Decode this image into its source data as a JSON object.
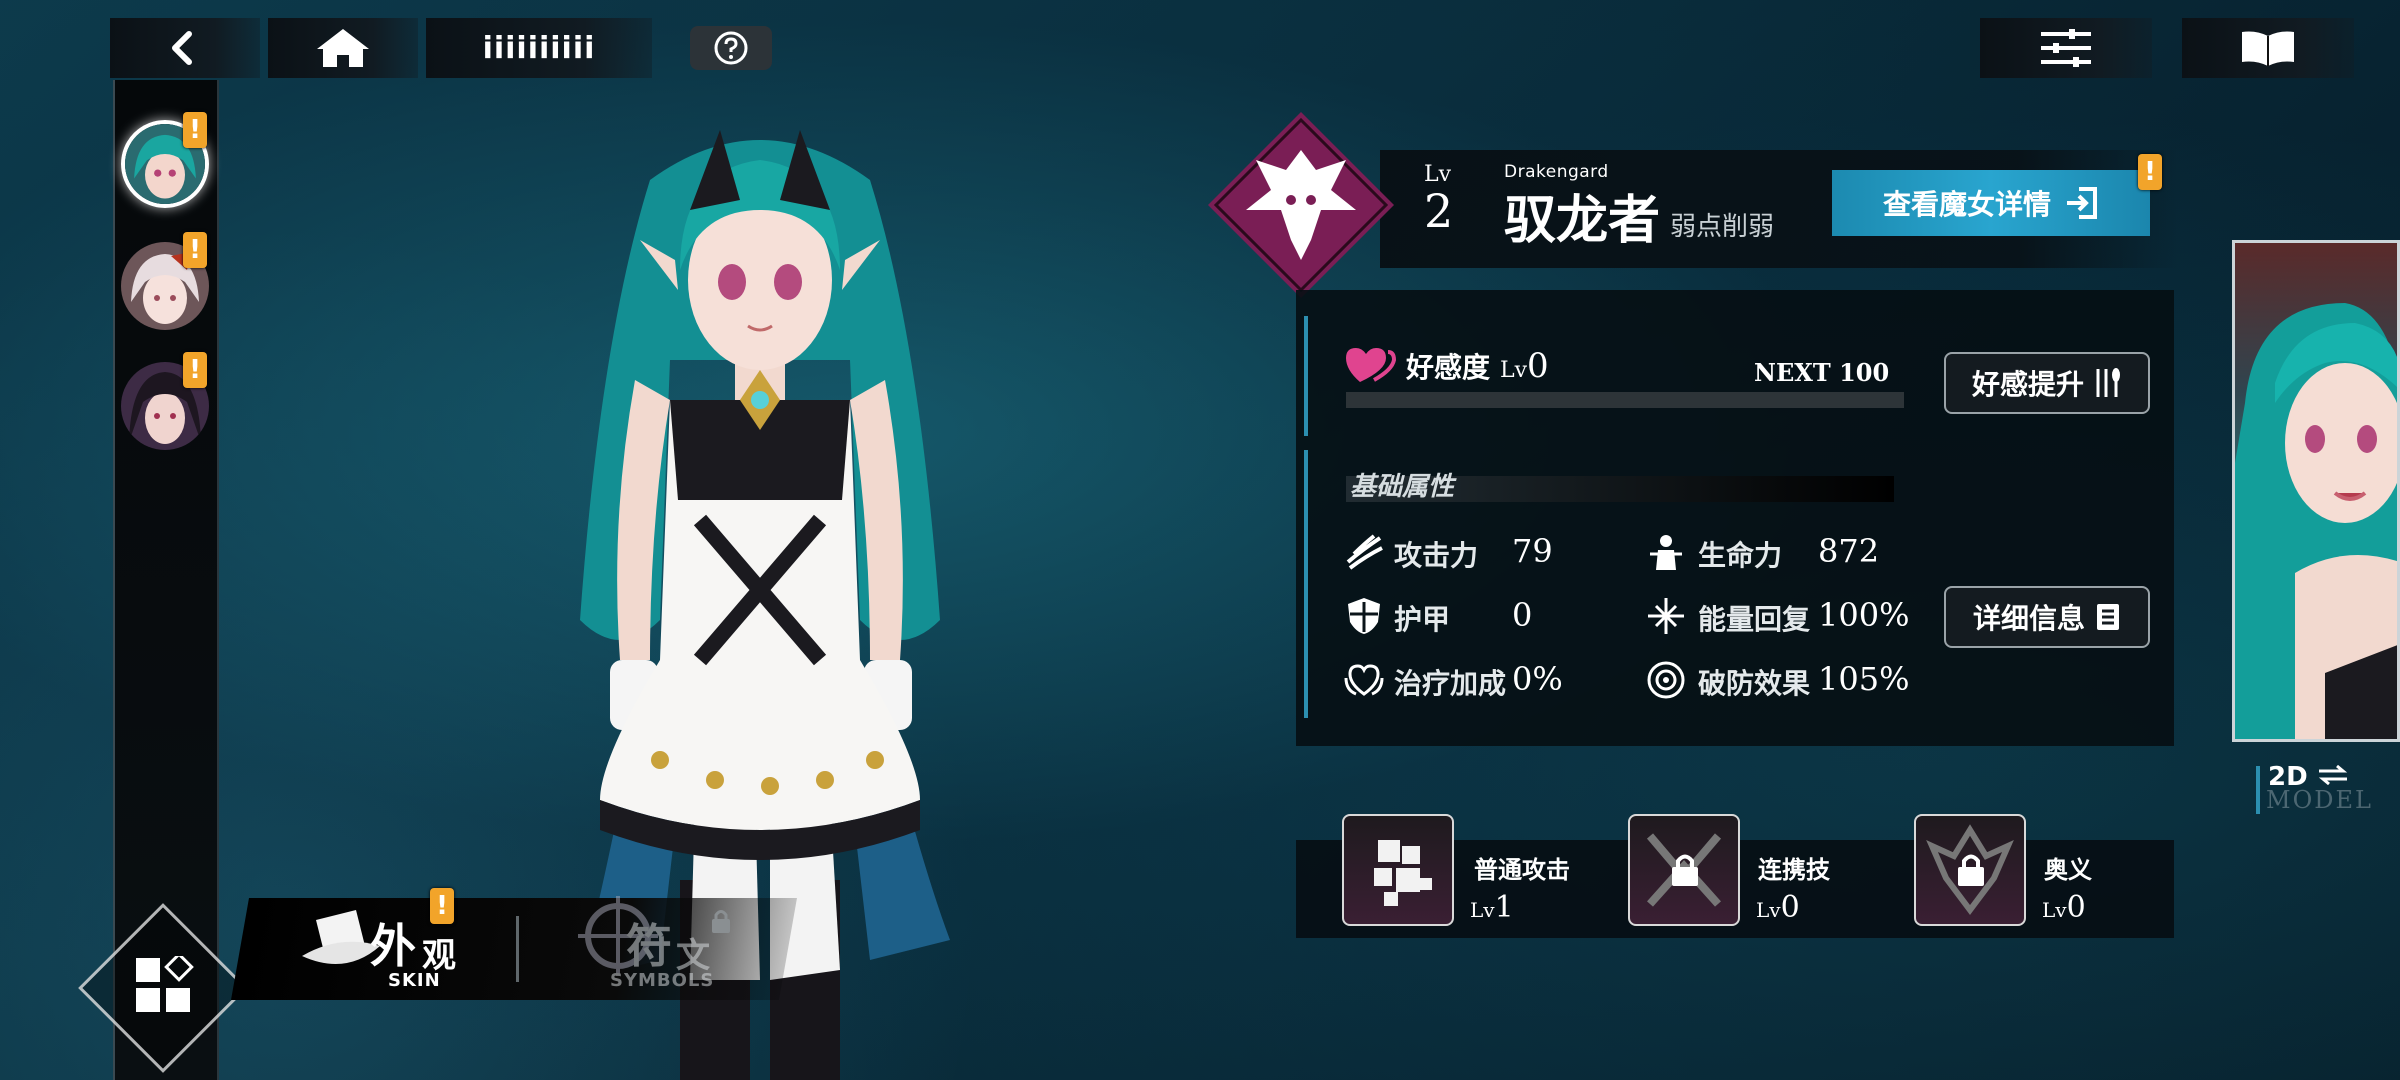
{
  "top_bar": {
    "title": "iiiiiiiiii",
    "help_icon": "question-circle-icon"
  },
  "roster": {
    "characters": [
      {
        "name": "teal-haired-witch",
        "selected": true,
        "alert": "!"
      },
      {
        "name": "white-haired-witch",
        "selected": false,
        "alert": "!"
      },
      {
        "name": "dark-haired-witch",
        "selected": false,
        "alert": "!"
      }
    ]
  },
  "bottom_tabs": {
    "skin": {
      "label_a": "外",
      "label_b": "观",
      "sub": "SKIN",
      "alert": "!"
    },
    "symbols": {
      "label_a": "符",
      "label_b": "文",
      "sub": "SYMBOLS",
      "locked": true
    }
  },
  "character": {
    "lv_label": "Lv",
    "level": "2",
    "class_en": "Drakengard",
    "name": "驭龙者",
    "tag": "弱点削弱",
    "detail_button": "查看魔女详情",
    "detail_alert": "!"
  },
  "affection": {
    "label": "好感度",
    "lv_prefix": "Lv",
    "level": "0",
    "next": "NEXT 100",
    "progress": 0,
    "button": "好感提升"
  },
  "base_stats": {
    "title": "基础属性",
    "left": [
      {
        "label": "攻击力",
        "value": "79",
        "icon": "claw-icon"
      },
      {
        "label": "护甲",
        "value": "0",
        "icon": "shield-icon"
      },
      {
        "label": "治疗加成",
        "value": "0%",
        "icon": "heal-heart-icon"
      }
    ],
    "right": [
      {
        "label": "生命力",
        "value": "872",
        "icon": "life-figure-icon"
      },
      {
        "label": "能量回复",
        "value": "100%",
        "icon": "energy-cross-icon"
      },
      {
        "label": "破防效果",
        "value": "105%",
        "icon": "target-icon"
      }
    ],
    "detail_button": "详细信息"
  },
  "skills": [
    {
      "name": "普通攻击",
      "lv_prefix": "Lv",
      "level": "1",
      "locked": false
    },
    {
      "name": "连携技",
      "lv_prefix": "Lv",
      "level": "0",
      "locked": true
    },
    {
      "name": "奥义",
      "lv_prefix": "Lv",
      "level": "0",
      "locked": true
    }
  ],
  "model_toggle": {
    "label": "2D",
    "sub": "MODEL"
  },
  "colors": {
    "accent_blue": "#29a5cf",
    "alert_orange": "#f2a42a",
    "affection_pink": "#d3409a",
    "emblem_magenta": "#7a1e55"
  }
}
